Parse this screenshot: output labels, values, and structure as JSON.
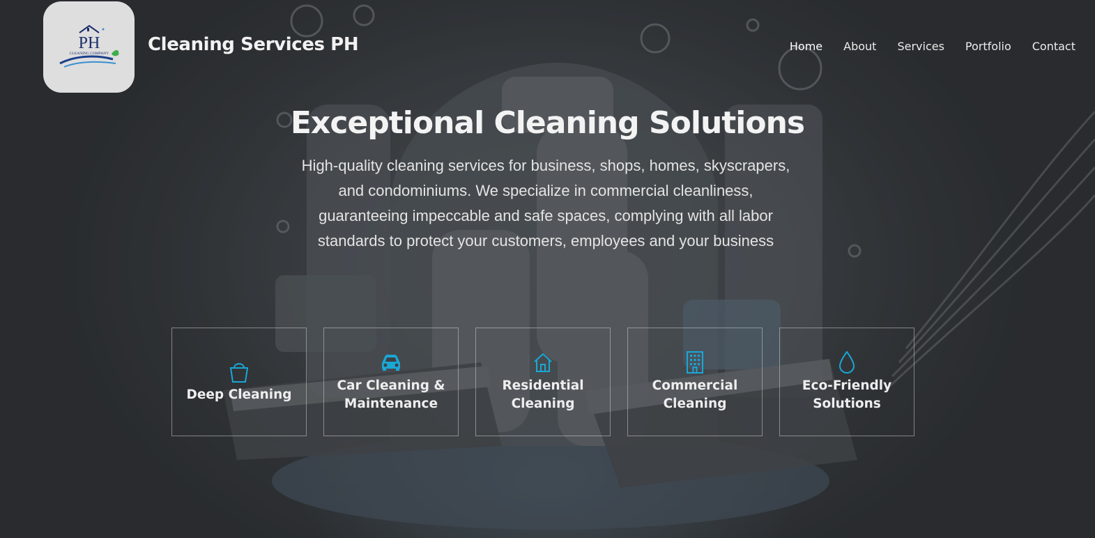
{
  "header": {
    "logo_text": "PH",
    "logo_subtext": "CLEANING COMPANY",
    "brand": "Cleaning Services PH"
  },
  "nav": {
    "items": [
      {
        "label": "Home",
        "active": true
      },
      {
        "label": "About"
      },
      {
        "label": "Services"
      },
      {
        "label": "Portfolio"
      },
      {
        "label": "Contact"
      }
    ]
  },
  "hero": {
    "title": "Exceptional Cleaning Solutions",
    "description": "High-quality cleaning services for business, shops, homes, skyscrapers, and condominiums. We specialize in commercial cleanliness, guaranteeing impeccable and safe spaces, complying with all labor standards to protect your customers, employees and your business"
  },
  "services": [
    {
      "label": "Deep Cleaning",
      "icon": "bucket-icon"
    },
    {
      "label": "Car Cleaning & Maintenance",
      "icon": "car-icon"
    },
    {
      "label": "Residential Cleaning",
      "icon": "house-icon"
    },
    {
      "label": "Commercial Cleaning",
      "icon": "building-icon"
    },
    {
      "label": "Eco-Friendly Solutions",
      "icon": "water-drop-icon"
    }
  ],
  "colors": {
    "icon_accent": "#1aa7d6",
    "logo_navy": "#1b2f6b",
    "logo_bg": "#dedede"
  }
}
